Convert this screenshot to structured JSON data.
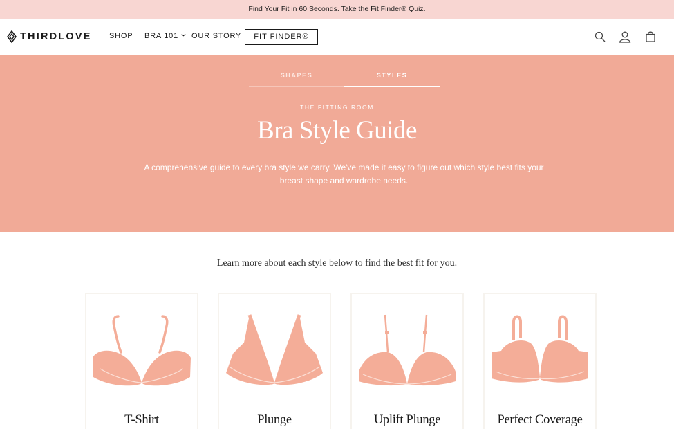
{
  "announcement": "Find Your Fit in 60 Seconds. Take the Fit Finder® Quiz.",
  "header": {
    "brand": "THIRDLOVE",
    "nav": {
      "shop": "SHOP",
      "bra101": "BRA 101",
      "story": "OUR STORY"
    },
    "fit_finder": "FIT FINDER®",
    "icons": [
      "search-icon",
      "account-icon",
      "cart-icon"
    ]
  },
  "hero": {
    "tabs": [
      {
        "label": "SHAPES"
      },
      {
        "label": "STYLES",
        "active": true
      }
    ],
    "eyebrow": "THE FITTING ROOM",
    "title": "Bra Style Guide",
    "description": "A comprehensive guide to every bra style we carry. We've made it easy to figure out which style best fits your breast shape and wardrobe needs."
  },
  "intro": "Learn more about each style below to find the best fit for you.",
  "styles": [
    {
      "label": "T-Shirt"
    },
    {
      "label": "Plunge"
    },
    {
      "label": "Uplift Plunge"
    },
    {
      "label": "Perfect Coverage"
    }
  ],
  "colors": {
    "announcement_bg": "#f8d6d2",
    "hero_bg": "#f1aa97",
    "bra_fill": "#f4ad98",
    "bra_line": "#fbe0d7"
  }
}
